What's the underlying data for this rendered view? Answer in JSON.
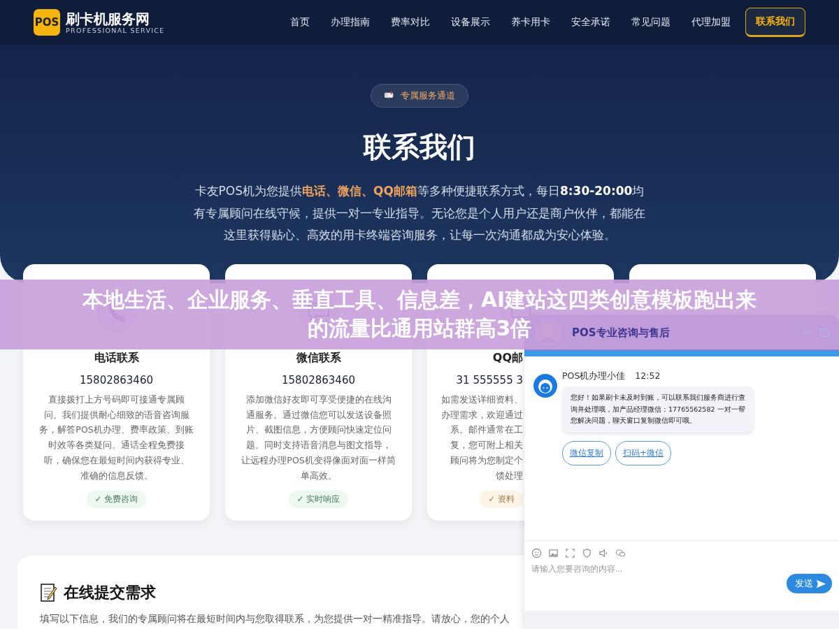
{
  "header": {
    "logo_mark": "POS",
    "brand": "刷卡机服务网",
    "tagline": "PROFESSIONAL SERVICE",
    "nav": [
      {
        "label": "首页",
        "selected": false
      },
      {
        "label": "办理指南",
        "selected": false
      },
      {
        "label": "费率对比",
        "selected": false
      },
      {
        "label": "设备展示",
        "selected": false
      },
      {
        "label": "养卡用卡",
        "selected": false
      },
      {
        "label": "安全承诺",
        "selected": false
      },
      {
        "label": "常见问题",
        "selected": false
      },
      {
        "label": "代理加盟",
        "selected": false
      },
      {
        "label": "联系我们",
        "selected": true
      }
    ]
  },
  "hero": {
    "badge": "专属服务通道",
    "title": "联系我们",
    "intro": [
      {
        "kind": "plain",
        "text": "卡友POS机为您提供"
      },
      {
        "kind": "accent",
        "text": "电话、微信、QQ邮箱"
      },
      {
        "kind": "plain",
        "text": "等多种便捷联系方式，每日"
      },
      {
        "kind": "strong",
        "text": "8:30-20:00"
      },
      {
        "kind": "plain",
        "text": "均有专属顾问在线守候，提供一对一专业指导。无论您是个人用户还是商户伙伴，都能在这里获得贴心、高效的用卡终端咨询服务，让每一次沟通都成为安心体验。"
      }
    ]
  },
  "cards": [
    {
      "kind": "full",
      "title": "电话联系",
      "contact": "15802863460",
      "lines": [
        "直接拨打上方号码即可接通专属顾",
        "问。我们提供耐心细致的语音咨询服",
        "务，解答POS机办理、费率政策、到账",
        "时效等各类疑问。通话全程免费接",
        "听，确保您在最短时间内获得专业、",
        "准确的信息反馈。"
      ],
      "badge": "✓ 免费咨询",
      "color": "#ecf8f0"
    },
    {
      "kind": "full",
      "title": "微信联系",
      "contact": "15802863460",
      "lines": [
        "添加微信好友即可享受便捷的在线沟",
        "通服务。通过微信您可以发送设备照",
        "片、截图信息，方便顾问快速定位问",
        "题。同时支持语音消息与图文指导，",
        "让远程办理POS机变得像面对面一样简",
        "单高效。"
      ],
      "badge": "✓ 实时响应",
      "color": "#ecf8f0"
    },
    {
      "kind": "clipped",
      "title": "QQ邮",
      "contact": "31 555555 3",
      "lines": [
        "如需发送详细资料、",
        "办理需求，欢迎通过",
        "系。邮件通常在工",
        "复，您可附上相关",
        "顾问将为您制定个",
        "馈处理"
      ],
      "badge": "✓ 资料",
      "color": "#fcf4e6"
    },
    {
      "kind": "hidden"
    }
  ],
  "form": {
    "title": "在线提交需求",
    "text": "填写以下信息，我们的专属顾问将在最短时间内与您取得联系，为您提供一对一精准指导。请放心，您的个人"
  },
  "chat": {
    "title": "POS专业咨询与售后",
    "sender": "POS机办理小佳",
    "time": "12:52",
    "message": "您好！如果刷卡未及时到账，可以联系我们服务商进行查询并处理哦，加产品经理微信：17765562582 一对一帮您解决问题，聊天窗口复制微信即可哦。",
    "actions": [
      "微信复制",
      "扫码+微信"
    ],
    "placeholder": "请输入您要咨询的内容...",
    "send": "发送"
  },
  "overlay_banner": {
    "lines": [
      "本地生活、企业服务、垂直工具、信息差，AI建站这四类创意模板跑出来",
      "的流量比通用站群高3倍"
    ]
  }
}
